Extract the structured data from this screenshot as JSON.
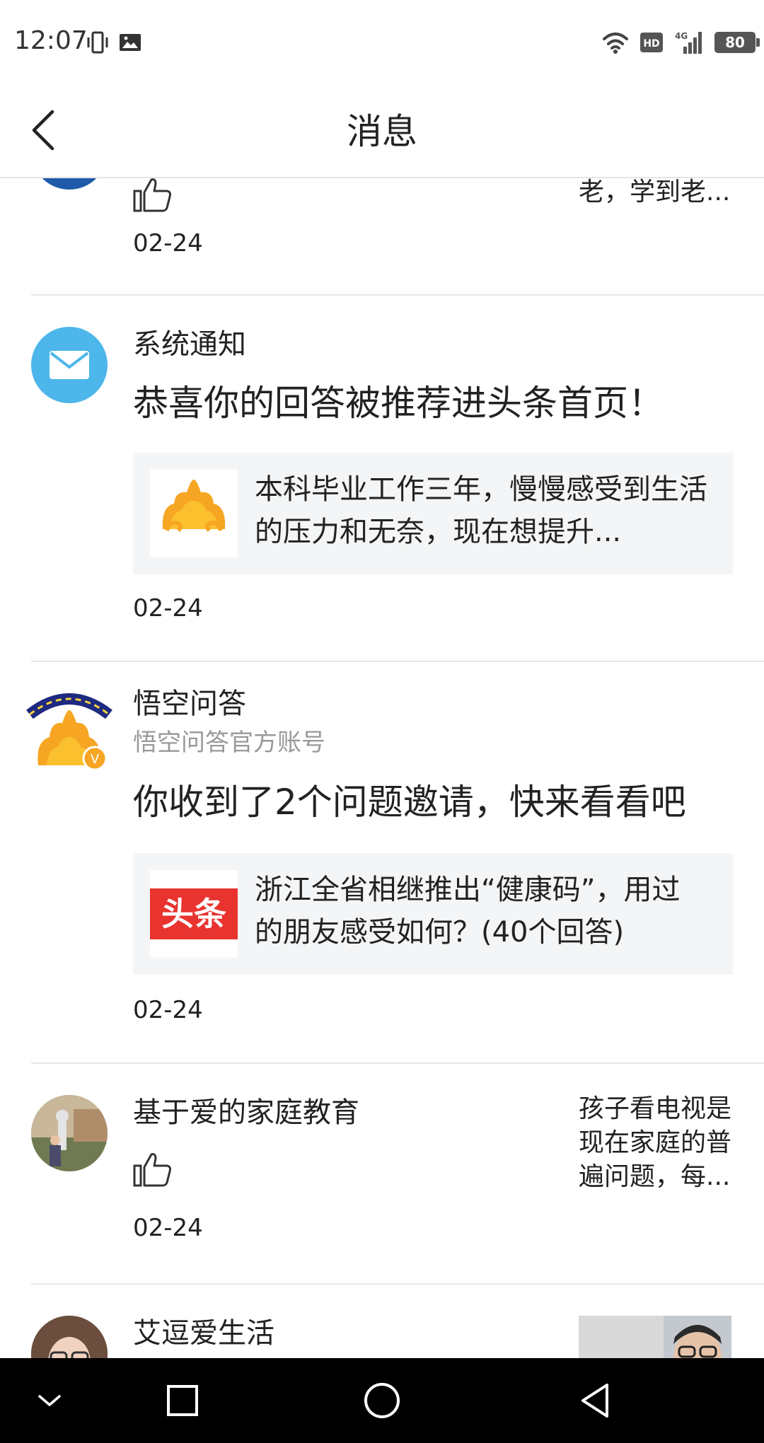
{
  "status_bar": {
    "time": "12:07",
    "battery": "80",
    "network_badge": "HD",
    "network_type": "4G"
  },
  "nav": {
    "title": "消息"
  },
  "messages": [
    {
      "snippet": "老，学到老...",
      "date": "02-24"
    },
    {
      "sender": "系统通知",
      "headline": "恭喜你的回答被推荐进头条首页！",
      "card_text": "本科毕业工作三年，慢慢感受到生活的压力和无奈，现在想提升...",
      "date": "02-24"
    },
    {
      "sender": "悟空问答",
      "subtitle": "悟空问答官方账号",
      "headline": "你收到了2个问题邀请，快来看看吧",
      "card_text": "浙江全省相继推出“健康码”，用过的朋友感受如何？(40个回答)",
      "card_logo_text": "头条",
      "verified_mark": "V",
      "date": "02-24"
    },
    {
      "sender": "基于爱的家庭教育",
      "snippet": "孩子看电视是现在家庭的普遍问题，每...",
      "date": "02-24"
    },
    {
      "sender": "艾逗爱生活"
    }
  ],
  "colors": {
    "system_icon_blue": "#4db6ea",
    "toutiao_red": "#e8332f",
    "card_bg": "#f4f5f6",
    "divider": "#e8e8e8"
  }
}
